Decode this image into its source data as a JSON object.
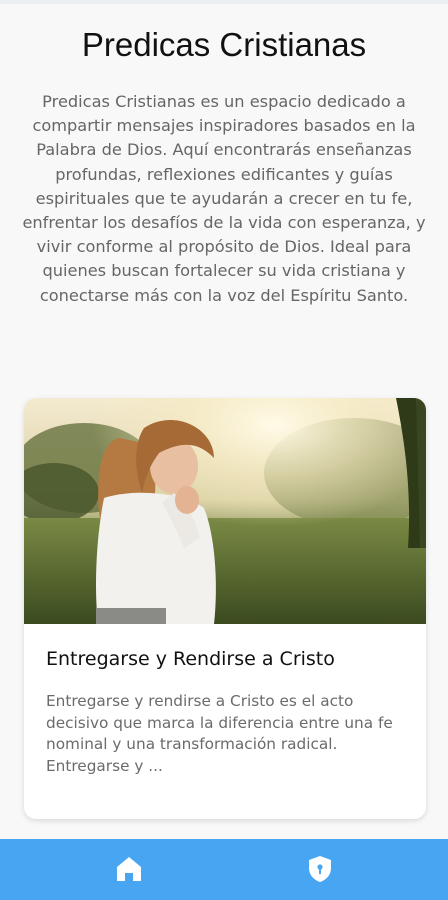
{
  "app": {
    "title": "Predicas Cristianas",
    "description": "Predicas Cristianas es un espacio dedicado a compartir mensajes inspiradores basados en la Palabra de Dios. Aquí encontrarás enseñanzas profundas, reflexiones edificantes y guías espirituales que te ayudarán a crecer en tu fe, enfrentar los desafíos de la vida con esperanza, y vivir conforme al propósito de Dios. Ideal para quienes buscan fortalecer su vida cristiana y conectarse más con la voz del Espíritu Santo."
  },
  "posts": [
    {
      "image": "woman-praying-in-park",
      "title": "Entregarse y Rendirse a Cristo",
      "excerpt": "Entregarse y rendirse a Cristo es el acto decisivo que marca la diferencia entre una fe nominal y una transformación radical. Entregarse y ..."
    }
  ],
  "nav": {
    "items": [
      {
        "icon": "home-icon",
        "active": true
      },
      {
        "icon": "shield-icon",
        "active": false
      }
    ]
  },
  "colors": {
    "background": "#f8f8f8",
    "nav_bar": "#47a5f2",
    "card": "#ffffff",
    "title_text": "#111111",
    "body_text": "#666666"
  }
}
